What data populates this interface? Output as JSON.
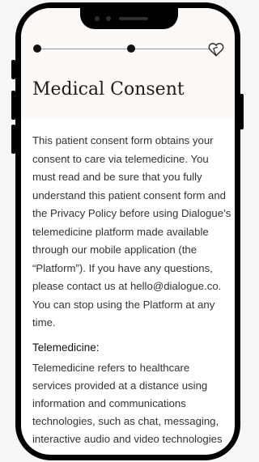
{
  "screen": {
    "title": "Medical Consent",
    "progress": {
      "steps_total": 3,
      "current_step": 2
    },
    "intro_paragraph": "This patient consent form obtains your consent to care via telemedicine. You must read and be sure that you fully understand this patient consent form and the Privacy Policy before using Dialogue’s telemedicine platform made available through our mobile application (the “Platform”). If you have any questions, please contact us at hello@dialogue.co. You can stop using the Platform at any time.",
    "section": {
      "heading": "Telemedicine:",
      "text": "Telemedicine refers to healthcare services provided at a distance using information and communications technologies, such as chat, messaging, interactive audio and video technologies"
    }
  },
  "icons": {
    "progress_end": "heart-outline-icon"
  },
  "colors": {
    "header_bg": "#fcf9f7",
    "progress_line": "#8d99ab",
    "dot": "#111111"
  }
}
